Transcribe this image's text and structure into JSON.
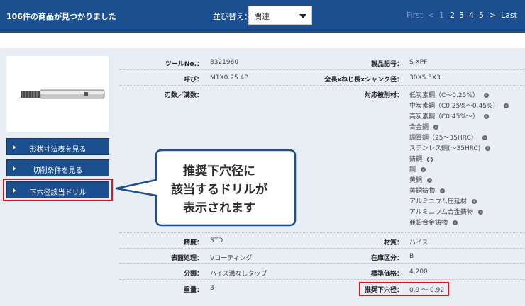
{
  "header": {
    "result_count": "106件の商品が見つかりました",
    "sort_label": "並び替え：",
    "sort_value": "関連",
    "pager": {
      "first": "First",
      "prev": "<",
      "pages": [
        "1",
        "2",
        "3",
        "4",
        "5"
      ],
      "next": ">",
      "last": "Last",
      "current": "1"
    }
  },
  "sidebar": {
    "buttons": [
      "形状寸法表を見る",
      "切削条件を見る",
      "下穴径該当ドリル"
    ]
  },
  "specs": {
    "tool_no_label": "ツールNo.：",
    "tool_no": "8321960",
    "product_code_label": "製品記号：",
    "product_code": "S-XPF",
    "thread_label": "呼び：",
    "thread": "M1X0.25 4P",
    "dims_label": "全長xねじ長xシャンク径：",
    "dims": "30X5.5X3",
    "teeth_label": "刃数／溝数：",
    "materials_label": "対応被削材：",
    "materials": [
      {
        "name": "低炭素鋼（C〜0.25%）",
        "mark": "◎"
      },
      {
        "name": "中炭素鋼（C0.25%〜0.45%）",
        "mark": "◎"
      },
      {
        "name": "高炭素鋼（C0.45%〜）",
        "mark": "◎"
      },
      {
        "name": "合金鋼",
        "mark": "◎"
      },
      {
        "name": "調質鋼（25〜35HRC）",
        "mark": "◎"
      },
      {
        "name": "ステンレス鋼(〜35HRC)",
        "mark": "◎"
      },
      {
        "name": "鋳鋼",
        "mark": "○"
      },
      {
        "name": "鋼",
        "mark": "◎"
      },
      {
        "name": "黄銅",
        "mark": "◎"
      },
      {
        "name": "黄銅鋳物",
        "mark": "◎"
      },
      {
        "name": "アルミニウム圧延材",
        "mark": "◎"
      },
      {
        "name": "アルミニウム合金鋳物",
        "mark": "◎"
      },
      {
        "name": "亜鉛合金鋳物",
        "mark": "◎"
      }
    ],
    "accuracy_label": "精度：",
    "accuracy": "STD",
    "material_label": "材質：",
    "material": "ハイス",
    "surface_label": "表面処理：",
    "surface": "Vコーティング",
    "stock_label": "在庫区分：",
    "stock": "B",
    "category_label": "分類：",
    "category": "ハイス溝なしタップ",
    "price_label": "標準価格：",
    "price": "4,200",
    "weight_label": "重量：",
    "weight": "3",
    "pilot_label": "推奨下穴径：",
    "pilot": "0.9 〜 0.92"
  },
  "callout": {
    "lines": [
      "推奨下穴径に",
      "該当するドリルが",
      "表示されます"
    ]
  },
  "colors": {
    "bar": "#1c4f8f",
    "content_bg": "#e9eef5",
    "highlight": "#e5101c"
  }
}
